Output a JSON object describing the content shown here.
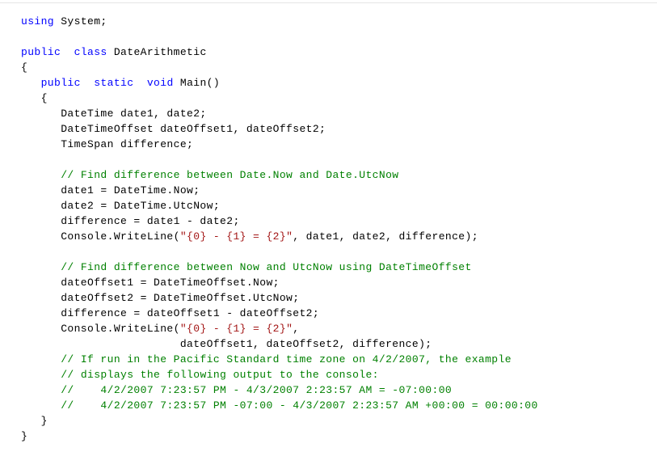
{
  "code": {
    "l1_kw": "using",
    "l1_ns": " System;",
    "blank1": "",
    "l2_kw": "public",
    "l2_kw2": "  class",
    "l2_rest": " DateArithmetic",
    "l3": "{",
    "l4_pad": "   ",
    "l4_kw": "public",
    "l4_kw2": "  static",
    "l4_kw3": "  void",
    "l4_rest": " Main()",
    "l5": "   {",
    "l6": "      DateTime date1, date2;",
    "l7": "      DateTimeOffset dateOffset1, dateOffset2;",
    "l8": "      TimeSpan difference;",
    "blank2": "",
    "l9_pad": "      ",
    "l9_com": "// Find difference between Date.Now and Date.UtcNow",
    "l10": "      date1 = DateTime.Now;",
    "l11": "      date2 = DateTime.UtcNow;",
    "l12": "      difference = date1 - date2;",
    "l13a": "      Console.WriteLine(",
    "l13s": "\"{0} - {1} = {2}\"",
    "l13b": ", date1, date2, difference);",
    "blank3": "",
    "l14_pad": "      ",
    "l14_com": "// Find difference between Now and UtcNow using DateTimeOffset",
    "l15": "      dateOffset1 = DateTimeOffset.Now;",
    "l16": "      dateOffset2 = DateTimeOffset.UtcNow;",
    "l17": "      difference = dateOffset1 - dateOffset2;",
    "l18a": "      Console.WriteLine(",
    "l18s": "\"{0} - {1} = {2}\"",
    "l18b": ",",
    "l19": "                        dateOffset1, dateOffset2, difference);",
    "l20_pad": "      ",
    "l20_com": "// If run in the Pacific Standard time zone on 4/2/2007, the example",
    "l21_pad": "      ",
    "l21_com": "// displays the following output to the console:",
    "l22_pad": "      ",
    "l22_com": "//    4/2/2007 7:23:57 PM - 4/3/2007 2:23:57 AM = -07:00:00",
    "l23_pad": "      ",
    "l23_com": "//    4/2/2007 7:23:57 PM -07:00 - 4/3/2007 2:23:57 AM +00:00 = 00:00:00",
    "l24": "   }",
    "l25": "}"
  }
}
